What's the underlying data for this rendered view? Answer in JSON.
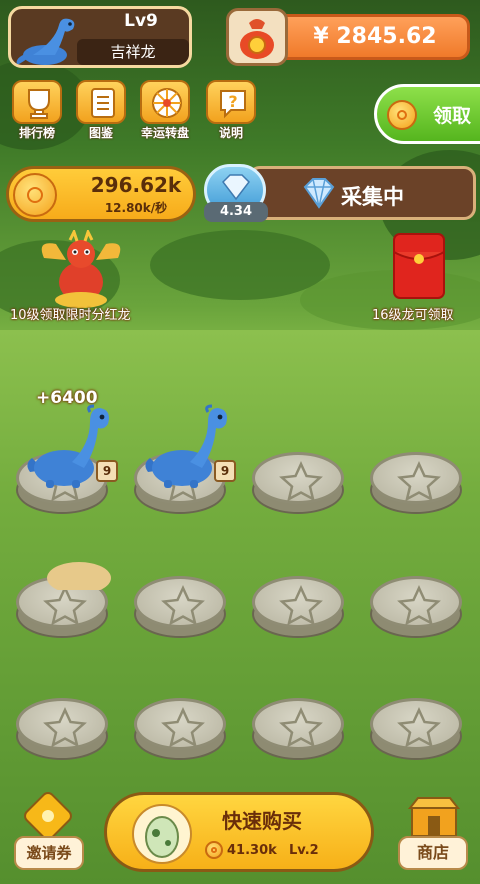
{
  "player": {
    "level": "Lv9",
    "name": "吉祥龙"
  },
  "wallet": {
    "balance": "¥ 2845.62"
  },
  "menu": [
    {
      "label": "排行榜",
      "icon": "trophy-icon"
    },
    {
      "label": "图鉴",
      "icon": "book-icon"
    },
    {
      "label": "幸运转盘",
      "icon": "wheel-icon"
    },
    {
      "label": "说明",
      "icon": "help-icon"
    }
  ],
  "claim": {
    "label": "领取"
  },
  "production": {
    "total": "296.62k",
    "rate": "12.80k/秒"
  },
  "gem": {
    "value": "4.34",
    "status": "采集中"
  },
  "promos": {
    "dividend_dragon": "10级领取限时分红龙",
    "red_packet": "16级龙可领取"
  },
  "board": {
    "gain": "+6400",
    "slots": [
      {
        "dragon": true,
        "level": "9"
      },
      {
        "dragon": true,
        "level": "9"
      },
      {
        "dragon": false
      },
      {
        "dragon": false
      },
      {
        "dragon": false
      },
      {
        "dragon": false
      },
      {
        "dragon": false
      },
      {
        "dragon": false
      },
      {
        "dragon": false
      },
      {
        "dragon": false
      },
      {
        "dragon": false
      },
      {
        "dragon": false
      }
    ]
  },
  "bottom": {
    "invite": "邀请券",
    "buy": {
      "title": "快速购买",
      "price": "41.30k",
      "level": "Lv.2"
    },
    "shop": "商店"
  },
  "colors": {
    "accent": "#f7b018",
    "grass": "#74ad3e",
    "dragon": "#3f82d6"
  }
}
